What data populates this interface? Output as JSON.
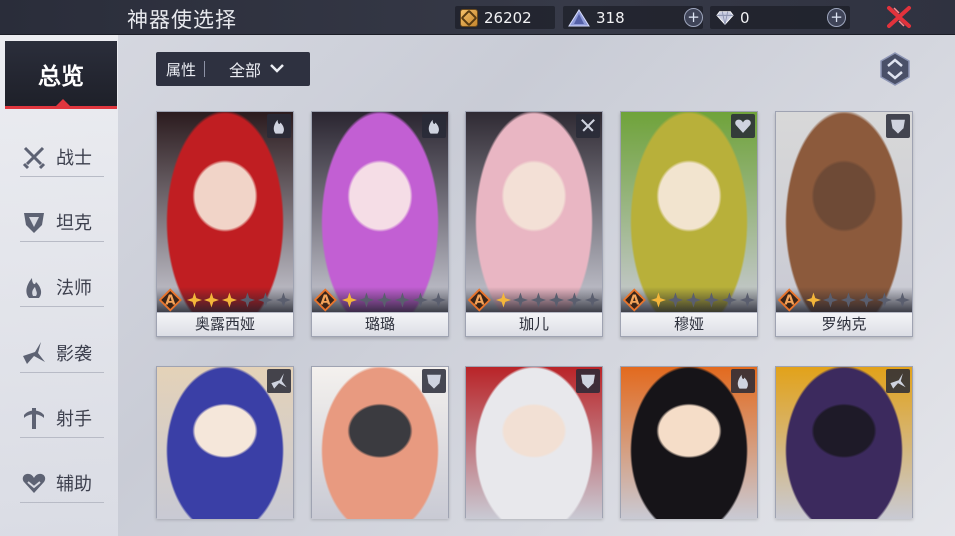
{
  "header": {
    "title": "神器使选择",
    "gold": "26202",
    "crystal": "318",
    "gems": "0"
  },
  "sidebar": {
    "all_label": "总览",
    "items": [
      {
        "label": "战士",
        "icon": "warrior-swords-icon"
      },
      {
        "label": "坦克",
        "icon": "tank-shield-icon"
      },
      {
        "label": "法师",
        "icon": "mage-flame-icon"
      },
      {
        "label": "影袭",
        "icon": "assassin-blade-icon"
      },
      {
        "label": "射手",
        "icon": "marksman-crossbow-icon"
      },
      {
        "label": "辅助",
        "icon": "support-heart-icon"
      }
    ]
  },
  "filter": {
    "label": "属性",
    "value": "全部"
  },
  "colors": {
    "accent_red": "#e0363e",
    "star_gold": "#f4b63a",
    "rank_orange": "#e8742c",
    "dark_panel": "#2e3140"
  },
  "cards": [
    {
      "name": "奥露西娅",
      "rank": "A",
      "stars": 3,
      "role": "mage-flame-icon"
    },
    {
      "name": "璐璐",
      "rank": "A",
      "stars": 1,
      "role": "mage-flame-icon"
    },
    {
      "name": "珈儿",
      "rank": "A",
      "stars": 1,
      "role": "warrior-swords-icon"
    },
    {
      "name": "穆娅",
      "rank": "A",
      "stars": 1,
      "role": "support-heart-icon"
    },
    {
      "name": "罗纳克",
      "rank": "A",
      "stars": 1,
      "role": "tank-shield-icon"
    },
    {
      "name": "",
      "rank": "",
      "stars": 0,
      "role": "assassin-blade-icon"
    },
    {
      "name": "",
      "rank": "",
      "stars": 0,
      "role": "tank-shield-icon"
    },
    {
      "name": "",
      "rank": "",
      "stars": 0,
      "role": "tank-shield-icon"
    },
    {
      "name": "",
      "rank": "",
      "stars": 0,
      "role": "mage-flame-icon"
    },
    {
      "name": "",
      "rank": "",
      "stars": 0,
      "role": "assassin-blade-icon"
    }
  ]
}
